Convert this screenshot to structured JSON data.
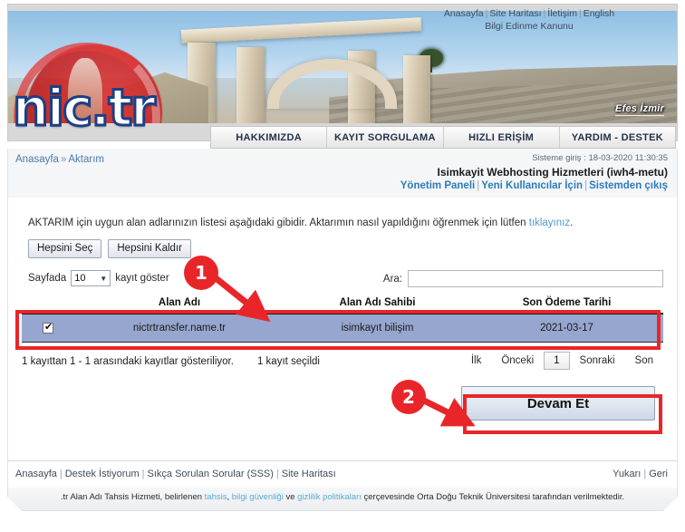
{
  "header": {
    "top_links": [
      {
        "label": "Anasayfa"
      },
      {
        "label": "Site Haritası"
      },
      {
        "label": "İletişim"
      },
      {
        "label": "English"
      }
    ],
    "top_links_line2": "Bilgi Edinme Kanunu",
    "logo_text": "nic.tr",
    "photo_caption": "Efes İzmir",
    "nav": [
      {
        "label": "HAKKIMIZDA"
      },
      {
        "label": "KAYIT SORGULAMA"
      },
      {
        "label": "HIZLI ERİŞİM"
      },
      {
        "label": "YARDIM - DESTEK"
      }
    ]
  },
  "breadcrumb": {
    "home": "Anasayfa",
    "separator": "»",
    "current": "Aktarım"
  },
  "session": {
    "login_time_label": "Sisteme giriş : 18-03-2020 11:30:35",
    "account": "Isimkayit Webhosting Hizmetleri (iwh4-metu)",
    "links": [
      {
        "label": "Yönetim Paneli"
      },
      {
        "label": "Yeni Kullanıcılar İçin"
      },
      {
        "label": "Sistemden çıkış"
      }
    ]
  },
  "main": {
    "intro_text": "AKTARIM için uygun alan adlarınızın listesi aşağıdaki gibidir. Aktarımın nasıl yapıldığını öğrenmek için lütfen ",
    "intro_link": "tıklayınız",
    "intro_end": ".",
    "select_all_button": "Hepsini Seç",
    "deselect_all_button": "Hepsini Kaldır",
    "length_prefix": "Sayfada",
    "length_value": "10",
    "length_suffix": "kayıt göster",
    "search_label": "Ara:",
    "search_value": "",
    "search_placeholder": "",
    "table": {
      "headers": [
        "",
        "Alan Adı",
        "Alan Adı Sahibi",
        "Son Ödeme Tarihi"
      ],
      "rows": [
        {
          "checked": true,
          "domain": "nictrtransfer.name.tr",
          "owner": "isimkayıt bilişim",
          "due_date": "2021-03-17",
          "selected": true
        }
      ]
    },
    "info_text": "1 kayıttan 1 - 1 arasındaki kayıtlar gösteriliyor.",
    "selected_text": "1 kayıt seçildi",
    "pagination": {
      "first": "İlk",
      "previous": "Önceki",
      "current_page": "1",
      "next": "Sonraki",
      "last": "Son"
    },
    "continue_button": "Devam Et"
  },
  "footer": {
    "links": [
      {
        "label": "Anasayfa"
      },
      {
        "label": "Destek İstiyorum"
      },
      {
        "label": "Sıkça Sorulan Sorular (SSS)"
      },
      {
        "label": "Site Haritası"
      }
    ],
    "right_links": [
      {
        "label": "Yukarı"
      },
      {
        "label": "Geri"
      }
    ],
    "legal_part1": ".tr Alan Adı Tahsis Hizmeti, belirlenen ",
    "legal_link1": "tahsis",
    "legal_sep1": ", ",
    "legal_link2": "bilgi güvenliği",
    "legal_part2": " ve ",
    "legal_link3": "gizlilik politikaları",
    "legal_part3": " çerçevesinde Orta Doğu Teknik Üniversitesi tarafından verilmektedir."
  },
  "annotations": [
    {
      "number": "1",
      "color": "#e8262a"
    },
    {
      "number": "2",
      "color": "#e8262a"
    }
  ]
}
